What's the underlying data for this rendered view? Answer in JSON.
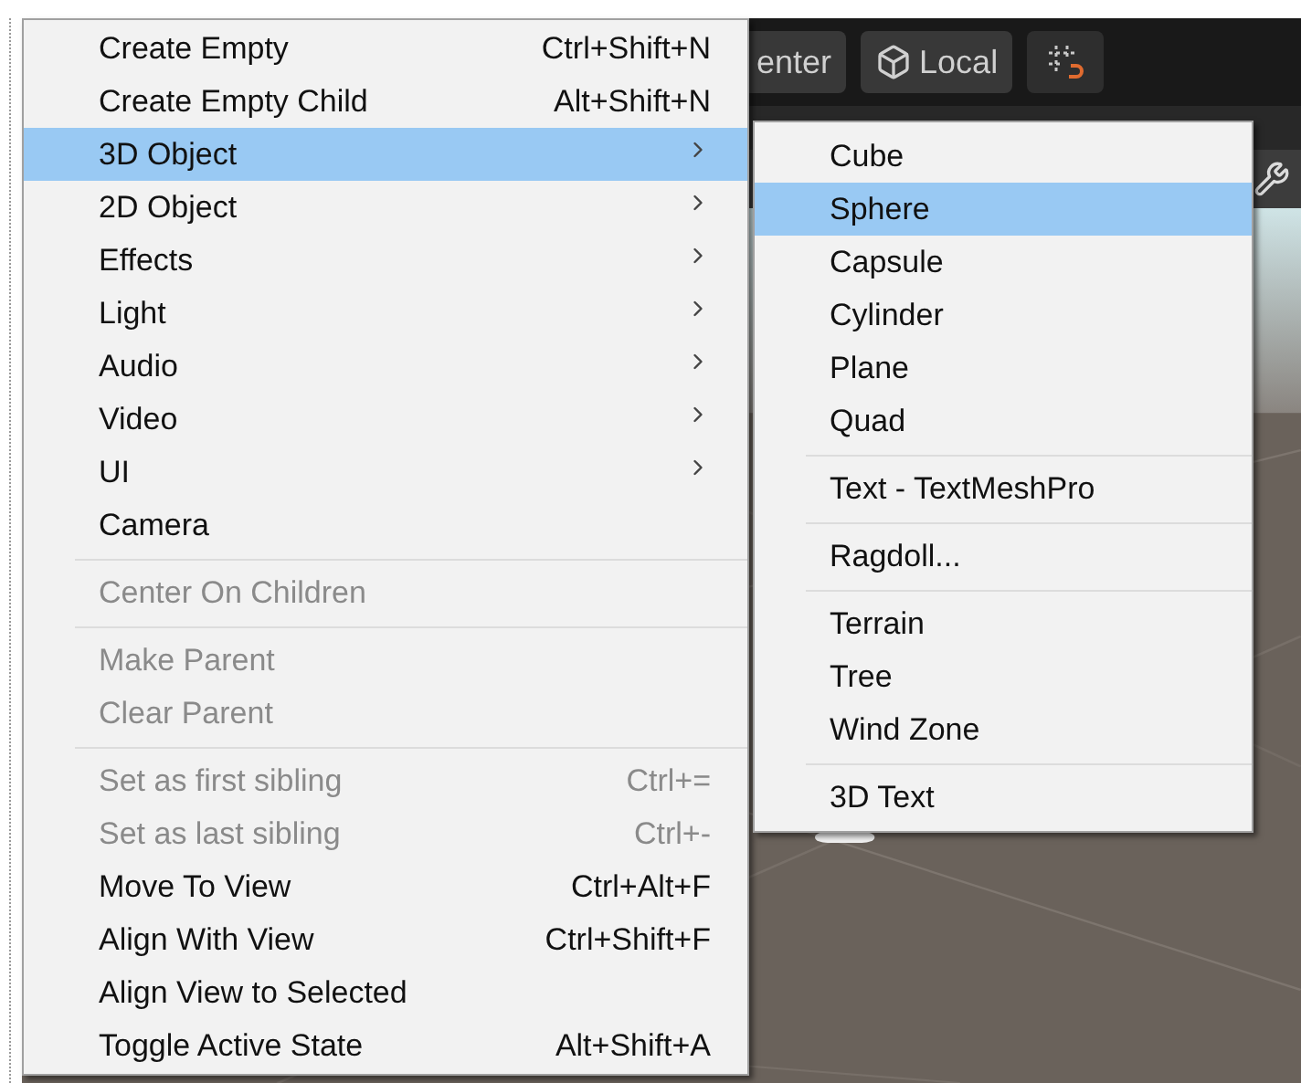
{
  "toolbar": {
    "pivot_button": "enter",
    "space_button": "Local"
  },
  "menu": [
    {
      "kind": "item",
      "label": "Create Empty",
      "shortcut": "Ctrl+Shift+N",
      "disabled": false,
      "selected": false,
      "submenu": false
    },
    {
      "kind": "item",
      "label": "Create Empty Child",
      "shortcut": "Alt+Shift+N",
      "disabled": false,
      "selected": false,
      "submenu": false
    },
    {
      "kind": "item",
      "label": "3D Object",
      "disabled": false,
      "selected": true,
      "submenu": true
    },
    {
      "kind": "item",
      "label": "2D Object",
      "disabled": false,
      "selected": false,
      "submenu": true
    },
    {
      "kind": "item",
      "label": "Effects",
      "disabled": false,
      "selected": false,
      "submenu": true
    },
    {
      "kind": "item",
      "label": "Light",
      "disabled": false,
      "selected": false,
      "submenu": true
    },
    {
      "kind": "item",
      "label": "Audio",
      "disabled": false,
      "selected": false,
      "submenu": true
    },
    {
      "kind": "item",
      "label": "Video",
      "disabled": false,
      "selected": false,
      "submenu": true
    },
    {
      "kind": "item",
      "label": "UI",
      "disabled": false,
      "selected": false,
      "submenu": true
    },
    {
      "kind": "item",
      "label": "Camera",
      "disabled": false,
      "selected": false,
      "submenu": false
    },
    {
      "kind": "separator"
    },
    {
      "kind": "item",
      "label": "Center On Children",
      "disabled": true,
      "selected": false,
      "submenu": false
    },
    {
      "kind": "separator"
    },
    {
      "kind": "item",
      "label": "Make Parent",
      "disabled": true,
      "selected": false,
      "submenu": false
    },
    {
      "kind": "item",
      "label": "Clear Parent",
      "disabled": true,
      "selected": false,
      "submenu": false
    },
    {
      "kind": "separator"
    },
    {
      "kind": "item",
      "label": "Set as first sibling",
      "shortcut": "Ctrl+=",
      "disabled": true,
      "selected": false,
      "submenu": false
    },
    {
      "kind": "item",
      "label": "Set as last sibling",
      "shortcut": "Ctrl+-",
      "disabled": true,
      "selected": false,
      "submenu": false
    },
    {
      "kind": "item",
      "label": "Move To View",
      "shortcut": "Ctrl+Alt+F",
      "disabled": false,
      "selected": false,
      "submenu": false
    },
    {
      "kind": "item",
      "label": "Align With View",
      "shortcut": "Ctrl+Shift+F",
      "disabled": false,
      "selected": false,
      "submenu": false
    },
    {
      "kind": "item",
      "label": "Align View to Selected",
      "disabled": false,
      "selected": false,
      "submenu": false
    },
    {
      "kind": "item",
      "label": "Toggle Active State",
      "shortcut": "Alt+Shift+A",
      "disabled": false,
      "selected": false,
      "submenu": false
    }
  ],
  "submenu": [
    {
      "kind": "item",
      "label": "Cube",
      "selected": false
    },
    {
      "kind": "item",
      "label": "Sphere",
      "selected": true
    },
    {
      "kind": "item",
      "label": "Capsule",
      "selected": false
    },
    {
      "kind": "item",
      "label": "Cylinder",
      "selected": false
    },
    {
      "kind": "item",
      "label": "Plane",
      "selected": false
    },
    {
      "kind": "item",
      "label": "Quad",
      "selected": false
    },
    {
      "kind": "separator"
    },
    {
      "kind": "item",
      "label": "Text - TextMeshPro",
      "selected": false
    },
    {
      "kind": "separator"
    },
    {
      "kind": "item",
      "label": "Ragdoll...",
      "selected": false
    },
    {
      "kind": "separator"
    },
    {
      "kind": "item",
      "label": "Terrain",
      "selected": false
    },
    {
      "kind": "item",
      "label": "Tree",
      "selected": false
    },
    {
      "kind": "item",
      "label": "Wind Zone",
      "selected": false
    },
    {
      "kind": "separator"
    },
    {
      "kind": "item",
      "label": "3D Text",
      "selected": false
    }
  ]
}
